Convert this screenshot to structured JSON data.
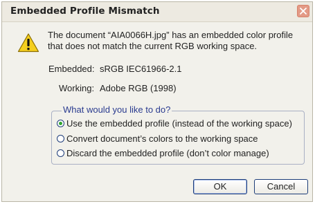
{
  "dialog": {
    "title": "Embedded Profile Mismatch",
    "message": "The document “AIA0066H.jpg” has an embedded color profile that does not match the current RGB working space.",
    "embedded_label": "Embedded:",
    "embedded_value": "sRGB IEC61966-2.1",
    "working_label": "Working:",
    "working_value": "Adobe RGB (1998)",
    "group_legend": "What would you like to do?",
    "options": [
      {
        "label": "Use the embedded profile (instead of the working space)",
        "selected": true
      },
      {
        "label": "Convert document’s colors to the working space",
        "selected": false
      },
      {
        "label": "Discard the embedded profile (don’t color manage)",
        "selected": false
      }
    ],
    "ok_label": "OK",
    "cancel_label": "Cancel"
  },
  "icons": {
    "warning": "warning-icon",
    "close": "close-icon"
  },
  "colors": {
    "dialog_bg": "#f2f1eb",
    "legend_text": "#2a3b8f",
    "warning_yellow": "#f5cf1f",
    "close_button": "#e39a86",
    "radio_selected": "#2fa32f"
  }
}
